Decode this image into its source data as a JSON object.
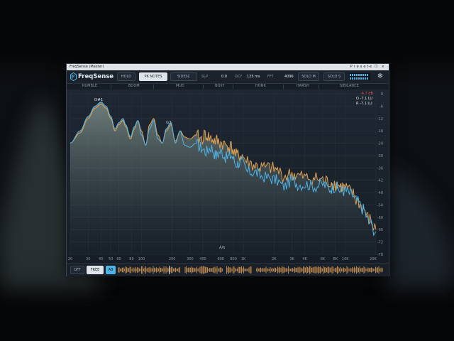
{
  "window": {
    "title": "FreqSense (Master)",
    "controls": "– ❐ ×",
    "presets_label": "Presets"
  },
  "toolbar": {
    "brand": "FreqSense",
    "hold_label": "HOLD",
    "pk_notes_label": "PK NOTES",
    "sidechain_label": "SIDESC",
    "slp_label": "SLP",
    "slp_value": "0.0",
    "dcy_label": "DCY",
    "dcy_value": "125 ms",
    "fft_label": "FFT",
    "fft_value": "4096",
    "solo_m_label": "SOLO M",
    "solo_s_label": "SOLO S",
    "settings_icon": "snowflake-icon"
  },
  "bands": [
    "RUMBLE",
    "BOOM",
    "MUD",
    "BOXY",
    "HONK",
    "HARSH",
    "SIBILANCE"
  ],
  "readout": {
    "peak": "-4.7 dB",
    "o_loudness": "O -7.1 LU",
    "r_loudness": "R -7.1 LU",
    "peak_color": "#e0554a"
  },
  "db_ticks": [
    "0",
    "-6",
    "-12",
    "-18",
    "-24",
    "-30",
    "-36",
    "-42",
    "-48",
    "-54",
    "-60",
    "-66",
    "-72",
    "-78"
  ],
  "freq_ticks": [
    "20",
    "30",
    "40",
    "50",
    "60",
    "80",
    "100",
    "200",
    "300",
    "400",
    "600",
    "800",
    "1K",
    "2K",
    "3K",
    "4K",
    "6K",
    "8K",
    "10K",
    "20K"
  ],
  "notes": {
    "low_peak": "D#1",
    "mid_peak": "G3",
    "cursor": "A/6"
  },
  "bottom": {
    "off_label": "OFF",
    "free_label": "FREE",
    "ab_label": "AB"
  },
  "colors": {
    "accent_blue": "#4fb3e6",
    "accent_orange": "#e0a052",
    "background": "#141a22"
  },
  "chart_data": {
    "type": "area",
    "xscale": "log",
    "xlim": [
      20,
      20000
    ],
    "ylim": [
      -78,
      0
    ],
    "ylabel": "",
    "xlabel": "",
    "grid": true,
    "series": [
      {
        "x": [
          20,
          25,
          30,
          35,
          40,
          45,
          50,
          55,
          60,
          66,
          70,
          78,
          85,
          92,
          100,
          110,
          120,
          132,
          145,
          160,
          175,
          195,
          215,
          240,
          265,
          300,
          340,
          380,
          430,
          480,
          540,
          600,
          680,
          760,
          850,
          950,
          1100,
          1300,
          1500,
          1800,
          2100,
          2500,
          3000,
          3500,
          4200,
          5000,
          6000,
          7000,
          8000,
          9000,
          10000,
          11500,
          13000,
          15000,
          17000,
          20000
        ],
        "values": [
          -24,
          -18,
          -11,
          -6,
          -4,
          -6,
          -11,
          -17,
          -14,
          -12,
          -15,
          -21,
          -16,
          -13,
          -20,
          -25,
          -17,
          -13,
          -22,
          -24,
          -17,
          -14,
          -24,
          -18,
          -25,
          -26,
          -24,
          -26,
          -28,
          -26,
          -30,
          -28,
          -31,
          -30,
          -34,
          -33,
          -38,
          -38,
          -40,
          -41,
          -42,
          -45,
          -42,
          -44,
          -44,
          -45,
          -44,
          -46,
          -45,
          -47,
          -47,
          -49,
          -52,
          -56,
          -62,
          -67
        ]
      },
      {
        "x": [
          20,
          25,
          30,
          35,
          40,
          45,
          50,
          55,
          60,
          66,
          70,
          78,
          85,
          92,
          100,
          110,
          120,
          132,
          145,
          160,
          175,
          195,
          215,
          240,
          265,
          300,
          340,
          380,
          430,
          480,
          540,
          600,
          680,
          760,
          850,
          950,
          1100,
          1300,
          1500,
          1800,
          2100,
          2500,
          3000,
          3500,
          4200,
          5000,
          6000,
          7000,
          8000,
          9000,
          10000,
          11500,
          13000,
          15000,
          17000,
          20000
        ],
        "values": [
          -24,
          -19,
          -12,
          -7,
          -5,
          -7,
          -12,
          -18,
          -15,
          -13,
          -16,
          -22,
          -17,
          -13,
          -18,
          -25,
          -15,
          -12,
          -20,
          -24,
          -18,
          -15,
          -23,
          -18,
          -21,
          -22,
          -20,
          -22,
          -20,
          -22,
          -23,
          -24,
          -25,
          -26,
          -30,
          -30,
          -33,
          -35,
          -36,
          -36,
          -37,
          -40,
          -39,
          -40,
          -41,
          -41,
          -42,
          -43,
          -44,
          -45,
          -46,
          -48,
          -52,
          -56,
          -61,
          -66
        ]
      }
    ]
  }
}
